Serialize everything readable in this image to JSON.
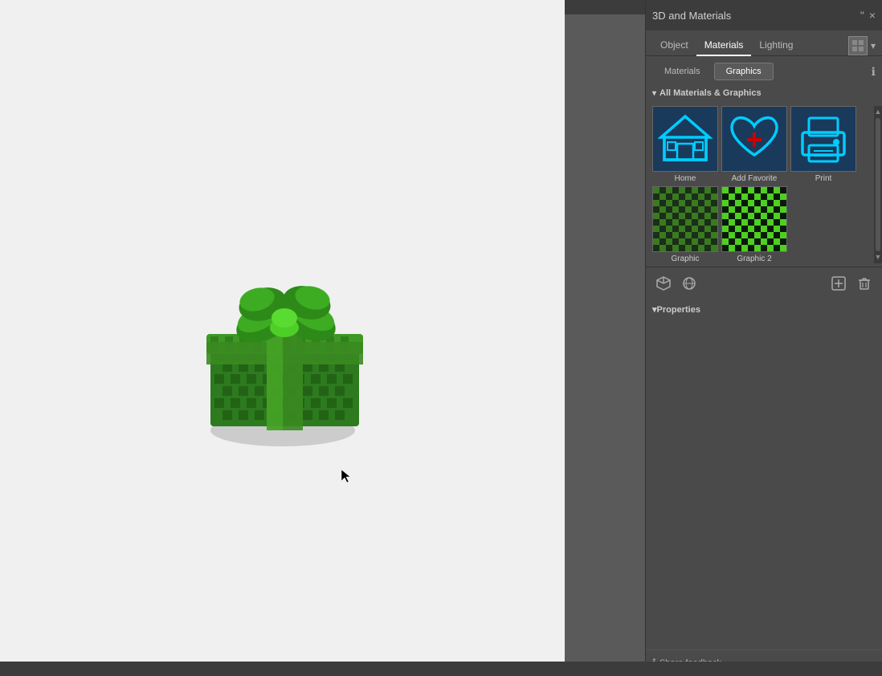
{
  "app": {
    "title": "3D and Materials",
    "top_bar_height": 18,
    "bottom_bar_height": 18
  },
  "panel": {
    "title": "3D and Materials",
    "close_btn": "×",
    "collapse_btn": "\"\"",
    "main_tabs": [
      {
        "label": "Object",
        "active": false
      },
      {
        "label": "Materials",
        "active": true
      },
      {
        "label": "Lighting",
        "active": false
      }
    ],
    "sub_tabs": [
      {
        "label": "Materials",
        "active": false
      },
      {
        "label": "Graphics",
        "active": true
      }
    ],
    "section_title": "All Materials & Graphics",
    "graphics": [
      {
        "label": "Home",
        "type": "home"
      },
      {
        "label": "Add Favorite",
        "type": "add-favorite"
      },
      {
        "label": "Print",
        "type": "print"
      },
      {
        "label": "Graphic",
        "type": "pixel-green-dark"
      },
      {
        "label": "Graphic 2",
        "type": "pixel-green-bright"
      }
    ],
    "properties_label": "Properties",
    "share_feedback_label": "Share feedback",
    "info_icon": "ℹ",
    "bottom_tools": [
      {
        "label": "📦",
        "name": "3d-object-tool"
      },
      {
        "label": "🎁",
        "name": "material-tool"
      }
    ],
    "add_btn": "+",
    "delete_btn": "🗑"
  },
  "canvas": {
    "background": "#f0f0f0"
  }
}
